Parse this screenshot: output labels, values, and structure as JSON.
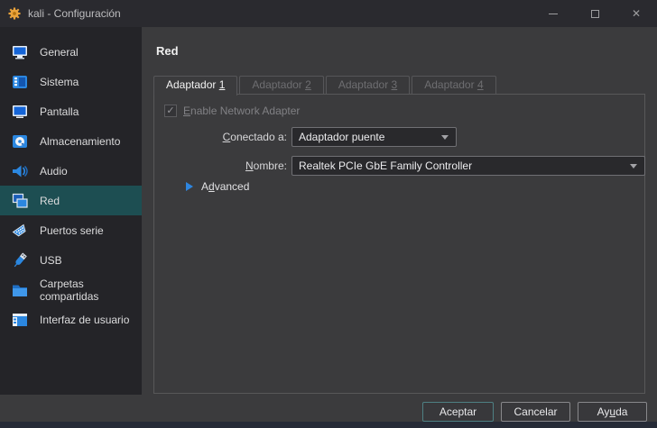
{
  "window": {
    "title": "kali - Configuración",
    "close_glyph": "✕"
  },
  "sidebar": {
    "items": [
      {
        "label": "General"
      },
      {
        "label": "Sistema"
      },
      {
        "label": "Pantalla"
      },
      {
        "label": "Almacenamiento"
      },
      {
        "label": "Audio"
      },
      {
        "label": "Red"
      },
      {
        "label": "Puertos serie"
      },
      {
        "label": "USB"
      },
      {
        "label": "Carpetas compartidas"
      },
      {
        "label": "Interfaz de usuario"
      }
    ]
  },
  "main": {
    "heading": "Red",
    "tabs": [
      {
        "pre": "Adaptador ",
        "num": "1"
      },
      {
        "pre": "Adaptador ",
        "num": "2"
      },
      {
        "pre": "Adaptador ",
        "num": "3"
      },
      {
        "pre": "Adaptador ",
        "num": "4"
      }
    ],
    "adapter": {
      "checkbox_glyph": "✓",
      "enable_key": "E",
      "enable_rest": "nable Network Adapter",
      "connected_key": "C",
      "connected_rest": "onectado a:",
      "connected_value": "Adaptador puente",
      "name_key": "N",
      "name_rest": "ombre:",
      "name_value": "Realtek PCIe GbE Family Controller",
      "advanced_pre": "A",
      "advanced_key": "d",
      "advanced_rest": "vanced"
    }
  },
  "footer": {
    "accept": "Aceptar",
    "cancel": "Cancelar",
    "help_pre": "Ay",
    "help_key": "u",
    "help_rest": "da"
  },
  "colors": {
    "selected_item_bg": "#1d4e52",
    "default_button_border": "#4e8083",
    "icon_blue": "#2b87e0",
    "gear_orange": "#e9a23b"
  }
}
